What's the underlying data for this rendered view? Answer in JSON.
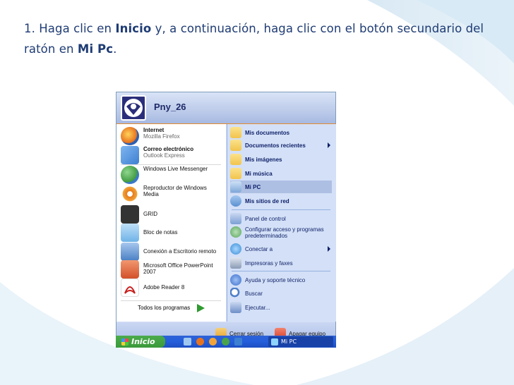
{
  "instruction": {
    "part1": "1. Haga clic en ",
    "bold1": "Inicio",
    "part2": " y, a continuación, haga clic con el botón secundario del ratón en ",
    "bold2": "Mi Pc",
    "part3": "."
  },
  "start_menu": {
    "user_name": "Pny_26",
    "pinned": [
      {
        "title": "Internet",
        "subtitle": "Mozilla Firefox",
        "icon": "firefox-icon",
        "color": "#e8731f"
      },
      {
        "title": "Correo electrónico",
        "subtitle": "Outlook Express",
        "icon": "outlook-express-icon",
        "color": "#3d7fd1"
      }
    ],
    "recent": [
      {
        "title": "Windows Live Messenger",
        "icon": "messenger-icon",
        "color": "#4aa34a"
      },
      {
        "title": "Reproductor de Windows Media",
        "icon": "media-player-icon",
        "color": "#e57a1a"
      },
      {
        "title": "GRID",
        "icon": "grid-icon",
        "color": "#333333"
      },
      {
        "title": "Bloc de notas",
        "icon": "notepad-icon",
        "color": "#6fb3e8"
      },
      {
        "title": "Conexión a Escritorio remoto",
        "icon": "remote-desktop-icon",
        "color": "#4a7fc4"
      },
      {
        "title": "Microsoft Office PowerPoint 2007",
        "icon": "powerpoint-icon",
        "color": "#d2502a"
      },
      {
        "title": "Adobe Reader 8",
        "icon": "adobe-reader-icon",
        "color": "#c8201e"
      }
    ],
    "all_programs": "Todos los programas",
    "right_items": [
      {
        "label": "Mis documentos",
        "icon": "my-documents-icon",
        "color": "#f2c44c",
        "bold": true
      },
      {
        "label": "Documentos recientes",
        "icon": "recent-documents-icon",
        "color": "#f2c44c",
        "bold": true,
        "submenu": true
      },
      {
        "label": "Mis imágenes",
        "icon": "my-pictures-icon",
        "color": "#f2c44c",
        "bold": true
      },
      {
        "label": "Mi música",
        "icon": "my-music-icon",
        "color": "#f2c44c",
        "bold": true
      },
      {
        "label": "Mi PC",
        "icon": "my-computer-icon",
        "color": "#7ea7d8",
        "bold": true,
        "selected": true
      },
      {
        "label": "Mis sitios de red",
        "icon": "network-places-icon",
        "color": "#5a90d0",
        "bold": true
      },
      {
        "label": "Panel de control",
        "icon": "control-panel-icon",
        "color": "#7c9fd4",
        "bold": false
      },
      {
        "label": "Configurar acceso y programas predeterminados",
        "icon": "default-programs-icon",
        "color": "#59a45a",
        "bold": false
      },
      {
        "label": "Conectar a",
        "icon": "connect-to-icon",
        "color": "#3a8dd6",
        "bold": false,
        "submenu": true
      },
      {
        "label": "Impresoras y faxes",
        "icon": "printers-icon",
        "color": "#8a9bb5",
        "bold": false
      },
      {
        "label": "Ayuda y soporte técnico",
        "icon": "help-icon",
        "color": "#3b6fd0",
        "bold": false
      },
      {
        "label": "Buscar",
        "icon": "search-icon",
        "color": "#4f7fc8",
        "bold": false
      },
      {
        "label": "Ejecutar...",
        "icon": "run-icon",
        "color": "#6d8ec7",
        "bold": false
      }
    ],
    "footer": {
      "logoff": "Cerrar sesión",
      "shutdown": "Apagar equipo",
      "logoff_color": "#e6a12c",
      "shutdown_color": "#d6402a"
    }
  },
  "taskbar": {
    "start_label": "Inicio",
    "quick_launch": [
      "desktop-icon",
      "firefox-icon",
      "media-player-icon",
      "messenger-icon",
      "outlook-express-icon"
    ],
    "window_item": "Mi PC"
  }
}
